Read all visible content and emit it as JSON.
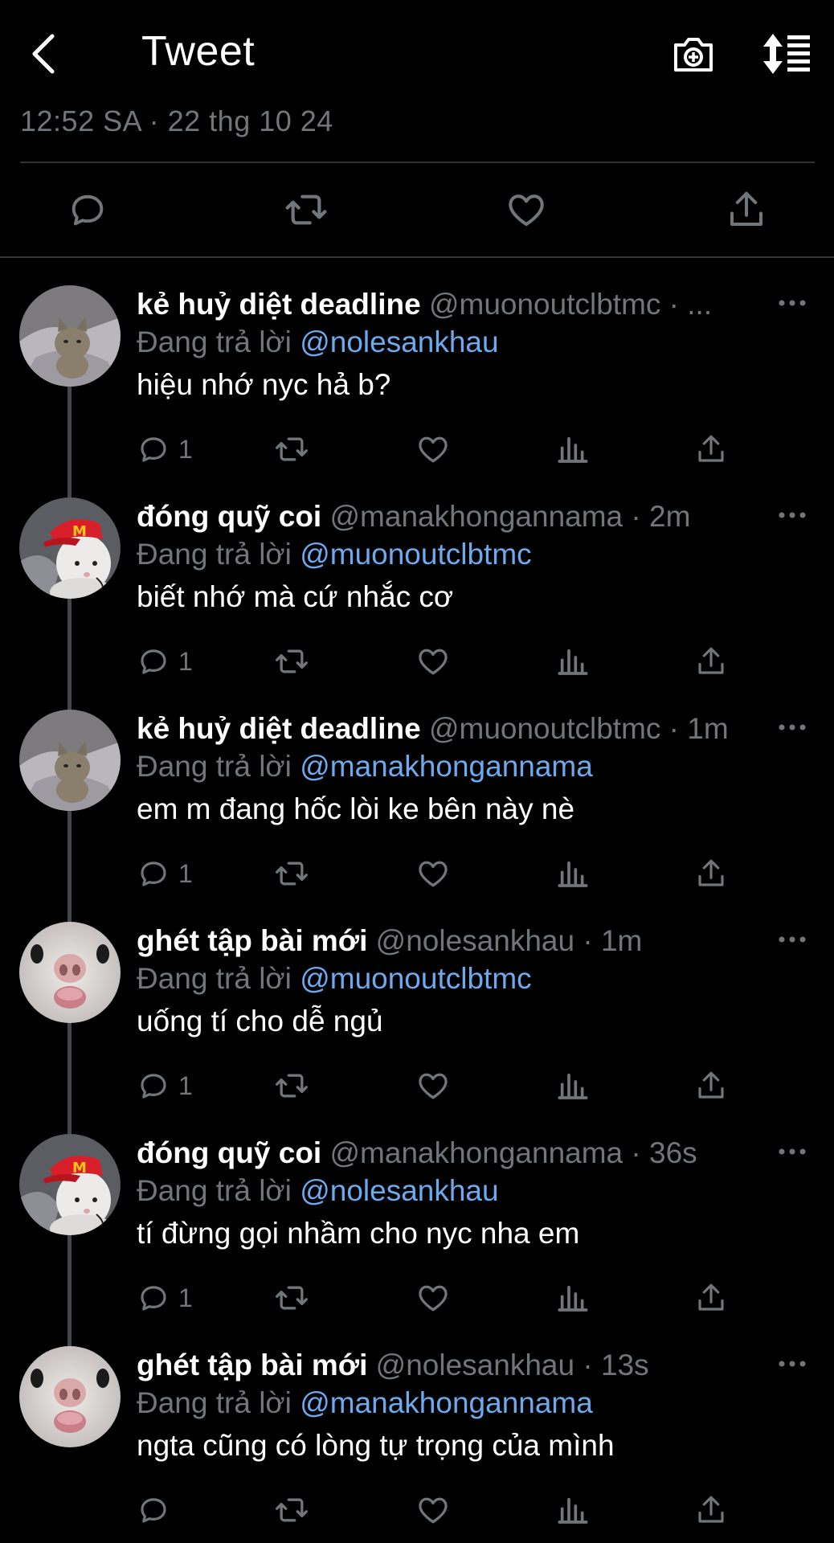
{
  "header": {
    "title": "Tweet",
    "back_icon": "chevron-left-icon",
    "camera_icon": "camera-plus-icon",
    "sort_icon": "sort-list-icon"
  },
  "tweet_meta": {
    "timestamp": "12:52 SA · 22 thg 10 24"
  },
  "tweet_actions": [
    "reply-icon",
    "retweet-icon",
    "like-icon",
    "share-icon"
  ],
  "colors": {
    "background": "#000000",
    "text": "#ffffff",
    "muted": "#71767b",
    "mention": "#6ea9ee",
    "divider": "#2f3336"
  },
  "replying_prefix": "Đang trả lời",
  "replies": [
    {
      "name": "kẻ huỷ diệt deadline",
      "handle": "@muonoutclbtmc · ...",
      "replying_to": "@nolesankhau",
      "text": "hiệu nhớ nyc hả b?",
      "reply_count": "1",
      "avatar": "cat-avatar"
    },
    {
      "name": "đóng quỹ coi",
      "handle": "@manakhongannama · 2m",
      "replying_to": "@muonoutclbtmc",
      "text": "biết nhớ mà cứ nhắc cơ",
      "reply_count": "1",
      "avatar": "rabbit-cap-avatar"
    },
    {
      "name": "kẻ huỷ diệt deadline",
      "handle": "@muonoutclbtmc · 1m",
      "replying_to": "@manakhongannama",
      "text": "em m đang hốc lòi ke bên này nè",
      "reply_count": "1",
      "avatar": "cat-avatar"
    },
    {
      "name": "ghét tập bài mới",
      "handle": "@nolesankhau · 1m",
      "replying_to": "@muonoutclbtmc",
      "text": "uống tí cho dễ ngủ",
      "reply_count": "1",
      "avatar": "bunny-nose-avatar"
    },
    {
      "name": "đóng quỹ coi",
      "handle": "@manakhongannama · 36s",
      "replying_to": "@nolesankhau",
      "text": "tí đừng gọi nhầm cho nyc nha em",
      "reply_count": "1",
      "avatar": "rabbit-cap-avatar"
    },
    {
      "name": "ghét tập bài mới",
      "handle": "@nolesankhau · 13s",
      "replying_to": "@manakhongannama",
      "text": "ngta cũng có lòng tự trọng của mình",
      "reply_count": "",
      "avatar": "bunny-nose-avatar"
    }
  ]
}
